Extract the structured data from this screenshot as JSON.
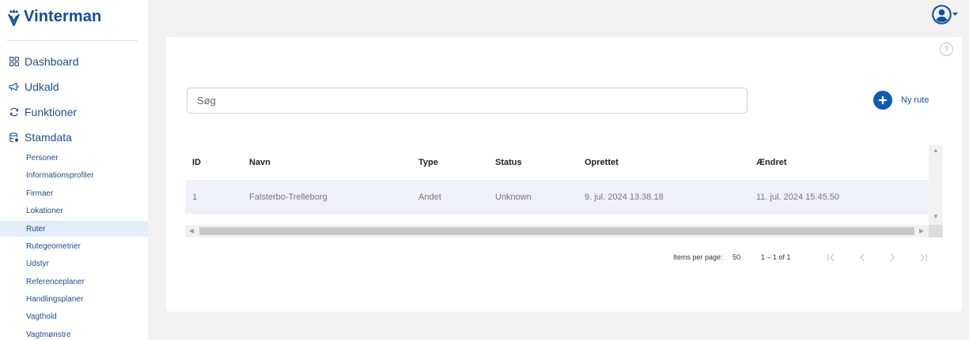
{
  "brand": {
    "name": "Vinterman",
    "color": "#0d4f9e"
  },
  "nav": {
    "main": [
      {
        "label": "Dashboard",
        "icon": "dashboard-icon"
      },
      {
        "label": "Udkald",
        "icon": "megaphone-icon"
      },
      {
        "label": "Funktioner",
        "icon": "sync-icon"
      },
      {
        "label": "Stamdata",
        "icon": "database-icon"
      }
    ],
    "stamdata": [
      {
        "label": "Personer"
      },
      {
        "label": "Informationsprofiler"
      },
      {
        "label": "Firmaer"
      },
      {
        "label": "Lokationer"
      },
      {
        "label": "Ruter",
        "active": true
      },
      {
        "label": "Rutegeometrier"
      },
      {
        "label": "Udstyr"
      },
      {
        "label": "Referenceplaner"
      },
      {
        "label": "Handlingsplaner"
      },
      {
        "label": "Vagthold"
      },
      {
        "label": "Vagtmønstre"
      }
    ]
  },
  "header": {
    "user_icon": "account-circle-icon"
  },
  "content": {
    "help_label": "?",
    "search": {
      "placeholder": "Søg",
      "value": ""
    },
    "new_button": {
      "label": "Ny rute",
      "icon": "plus-circle-icon",
      "color": "#0d5cb6"
    }
  },
  "table": {
    "columns": [
      "ID",
      "Navn",
      "Type",
      "Status",
      "Oprettet",
      "Ændret"
    ],
    "sort_icon": "↑",
    "rows": [
      [
        "1",
        "Falsterbo-Trelleborg",
        "Andet",
        "Unknown",
        "9. jul. 2024 13.38.18",
        "11. jul. 2024 15.45.50"
      ]
    ]
  },
  "paginator": {
    "items_per_page_label": "Items per page:",
    "page_size": "50",
    "range_label": "1 – 1 of 1"
  }
}
